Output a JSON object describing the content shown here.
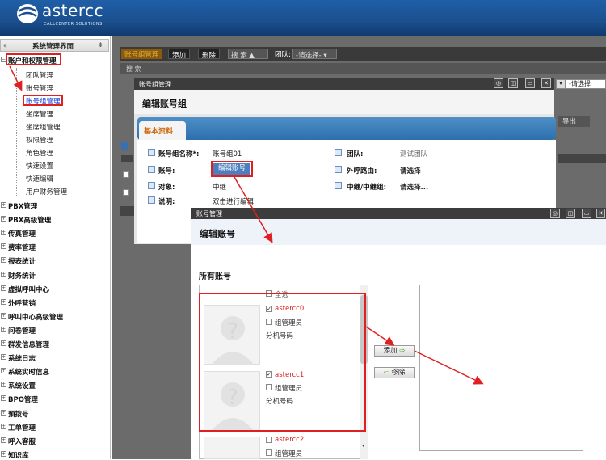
{
  "header": {
    "logo_text": "astercc",
    "logo_sub": "CALLCENTER SOLUTIONS"
  },
  "sidebar": {
    "collapse": "«",
    "title": "系统管理界面",
    "pin": "⇟",
    "top_group": "账户和权限管理",
    "sub_items": [
      "团队管理",
      "账号管理",
      "账号组管理",
      "坐席管理",
      "坐席组管理",
      "权限管理",
      "角色管理",
      "快速设置",
      "快速编辑",
      "用户财务管理"
    ],
    "groups": [
      "PBX管理",
      "PBX高级管理",
      "传真管理",
      "费率管理",
      "报表统计",
      "财务统计",
      "虚拟呼叫中心",
      "外呼营销",
      "呼叫中心高级管理",
      "问卷管理",
      "群发信息管理",
      "系统日志",
      "系统实时信息",
      "系统设置",
      "BPO管理",
      "预拨号",
      "工单管理",
      "呼入客服",
      "知识库"
    ]
  },
  "toolbar": {
    "orange": "账号组管理",
    "add": "添加",
    "delete": "删除",
    "search": "搜 索",
    "team_label": "团队:",
    "team_select": "-请选择-"
  },
  "search_bar": "搜 索",
  "right_partial": {
    "select": "-请选择",
    "export": "导出"
  },
  "dialog1": {
    "title": "账号组管理",
    "heading": "编辑账号组",
    "tab": "基本资料",
    "fields": {
      "name_label": "账号组名称*:",
      "name_value": "账号组01",
      "team_label": "团队:",
      "team_value": "测试团队",
      "account_label": "账号:",
      "edit_btn": "编辑账号",
      "outroute_label": "外呼路由:",
      "outroute_value": "请选择",
      "target_label": "对象:",
      "target_value": "中继",
      "trunk_label": "中继/中继组:",
      "trunk_value": "请选择...",
      "desc_label": "说明:",
      "desc_value": "双击进行编辑"
    },
    "controls": [
      "◎",
      "◫",
      "▭",
      "✕"
    ]
  },
  "dialog2": {
    "title": "账号管理",
    "heading": "编辑账号",
    "all_accounts": "所有账号",
    "select_all": "全选",
    "accounts": [
      {
        "name": "astercc0",
        "admin": "组管理员",
        "ext": "分机号码",
        "checked": true
      },
      {
        "name": "astercc1",
        "admin": "组管理员",
        "ext": "分机号码",
        "checked": true
      },
      {
        "name": "astercc2",
        "admin": "组管理员",
        "ext": "",
        "checked": false
      }
    ],
    "add_btn": "添加",
    "remove_btn": "移除",
    "controls": [
      "◎",
      "◫",
      "▭",
      "✕"
    ]
  },
  "colors": {
    "header_blue": "#1b4f8e",
    "highlight_red": "#e02020",
    "tab_blue": "#2d6fae",
    "orange": "#d06a10"
  }
}
